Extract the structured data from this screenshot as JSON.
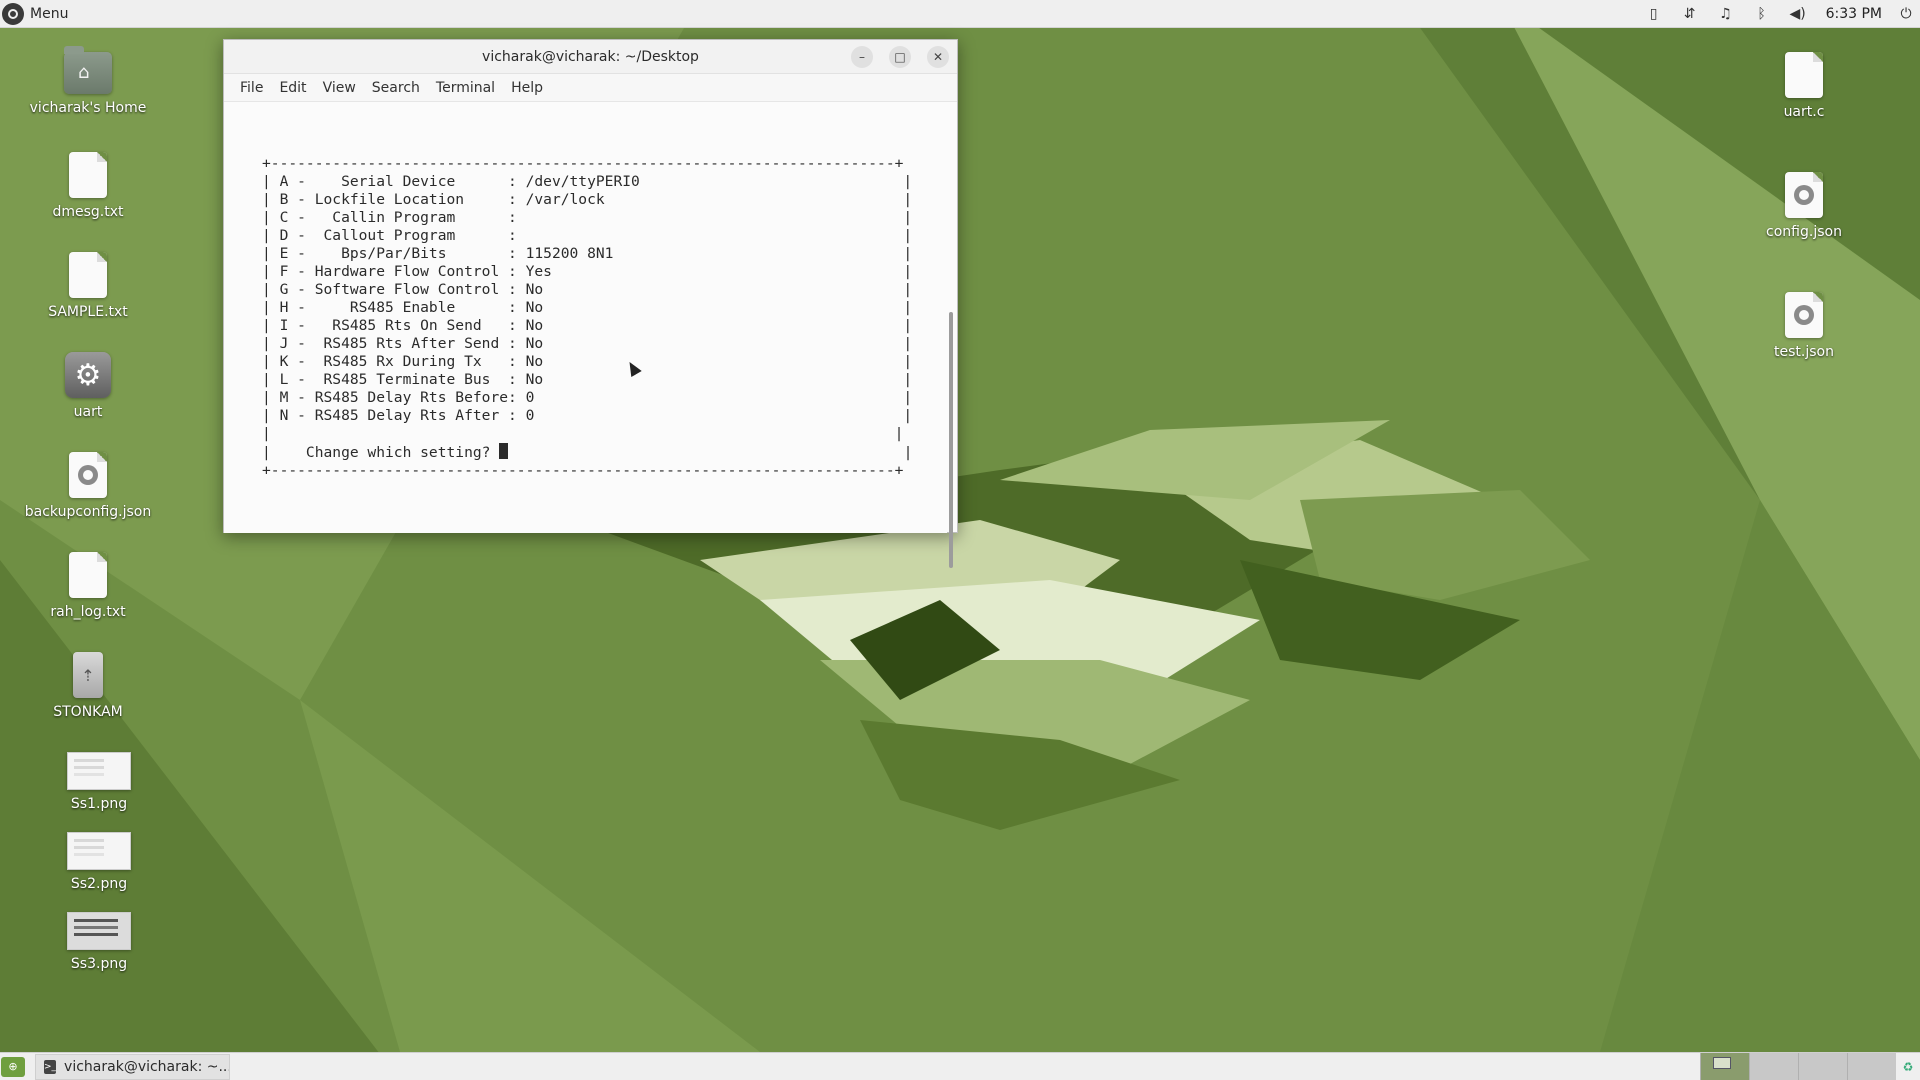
{
  "top_panel": {
    "menu_label": "Menu",
    "clock": "6:33 PM",
    "tray_icons": [
      "file-icon",
      "network-icon",
      "bell-icon",
      "bluetooth-icon",
      "volume-icon",
      "power-icon"
    ]
  },
  "desktop_left": [
    {
      "label": "vicharak's Home",
      "icon": "home-folder-icon"
    },
    {
      "label": "dmesg.txt",
      "icon": "text-file-icon"
    },
    {
      "label": "SAMPLE.txt",
      "icon": "text-file-icon"
    },
    {
      "label": "uart",
      "icon": "gear-icon"
    },
    {
      "label": "backupconfig.json",
      "icon": "json-file-icon"
    },
    {
      "label": "rah_log.txt",
      "icon": "text-file-icon"
    },
    {
      "label": "STONKAM",
      "icon": "usb-drive-icon"
    },
    {
      "label": "Ss1.png",
      "icon": "image-thumbnail-icon"
    },
    {
      "label": "Ss2.png",
      "icon": "image-thumbnail-icon"
    },
    {
      "label": "Ss3.png",
      "icon": "image-thumbnail-icon"
    }
  ],
  "desktop_right": [
    {
      "label": "uart.c",
      "icon": "text-file-icon"
    },
    {
      "label": "config.json",
      "icon": "json-file-icon"
    },
    {
      "label": "test.json",
      "icon": "json-file-icon"
    }
  ],
  "terminal": {
    "title": "vicharak@vicharak: ~/Desktop",
    "menus": [
      "File",
      "Edit",
      "View",
      "Search",
      "Terminal",
      "Help"
    ],
    "lines": [
      "+-----------------------------------------------------------------------+",
      "| A -    Serial Device      : /dev/ttyPERI0                              |",
      "| B - Lockfile Location     : /var/lock                                  |",
      "| C -   Callin Program      :                                            |",
      "| D -  Callout Program      :                                            |",
      "| E -    Bps/Par/Bits       : 115200 8N1                                 |",
      "| F - Hardware Flow Control : Yes                                        |",
      "| G - Software Flow Control : No                                         |",
      "| H -     RS485 Enable      : No                                         |",
      "| I -   RS485 Rts On Send   : No                                         |",
      "| J -  RS485 Rts After Send : No                                         |",
      "| K -  RS485 Rx During Tx   : No                                         |",
      "| L -  RS485 Terminate Bus  : No                                         |",
      "| M - RS485 Delay Rts Before: 0                                          |",
      "| N - RS485 Delay Rts After : 0                                          |",
      "|                                                                       |",
      "|    Change which setting? "
    ],
    "prompt_tail": "                                             |",
    "bottom_line": "+-----------------------------------------------------------------------+"
  },
  "bottom_panel": {
    "task_label": "vicharak@vicharak: ~..."
  }
}
